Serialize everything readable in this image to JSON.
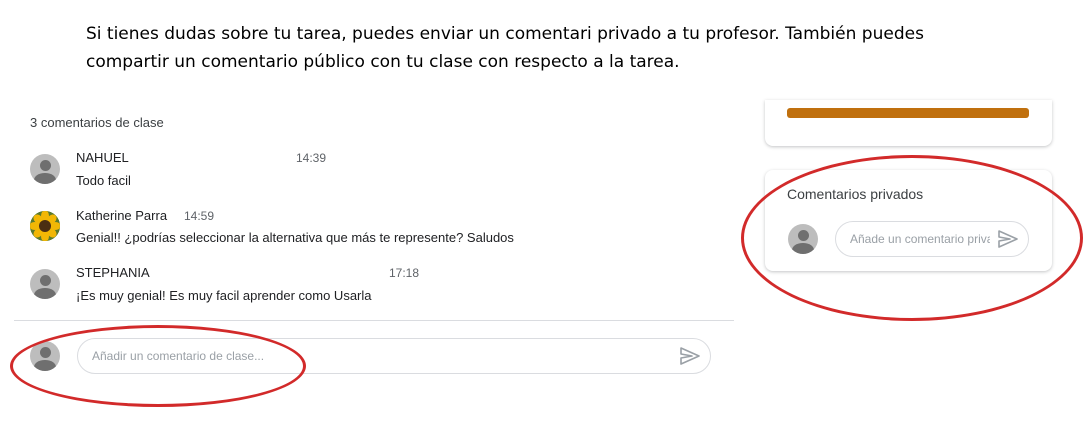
{
  "intro": {
    "line1": "Si tienes dudas sobre tu tarea, puedes enviar un comentari privado a tu profesor. También puedes",
    "line2": "compartir un comentario público con tu clase con respecto a la tarea."
  },
  "class_comments": {
    "count_label": "3 comentarios de clase",
    "items": [
      {
        "author": "NAHUEL",
        "time": "14:39",
        "text": "Todo facil",
        "avatar": "person-icon"
      },
      {
        "author": "Katherine Parra",
        "time": "14:59",
        "text": "Genial!! ¿podrías seleccionar la alternativa que más te represente? Saludos",
        "avatar": "sunflower-photo"
      },
      {
        "author": "STEPHANIA",
        "time": "17:18",
        "text": "¡Es muy genial! Es muy facil aprender como Usarla",
        "avatar": "person-icon"
      }
    ],
    "input_placeholder": "Añadir un comentario de clase..."
  },
  "private_comments": {
    "title": "Comentarios privados",
    "input_placeholder": "Añade un comentario privado..."
  },
  "colors": {
    "annotation_red": "#d22a2a",
    "accent_bar": "#c0700e",
    "avatar_gray": "#bdbdbd"
  }
}
